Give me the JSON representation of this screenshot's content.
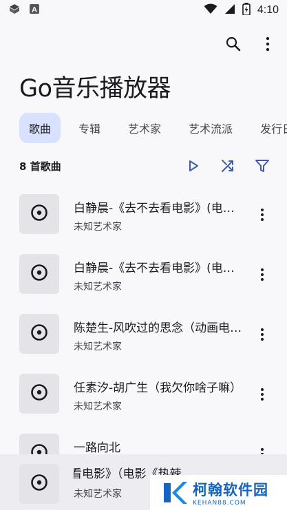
{
  "status_bar": {
    "time": "4:10",
    "left_icons": [
      "box-icon",
      "a-badge-icon"
    ],
    "right_icons": [
      "wifi-icon",
      "signal-icon",
      "battery-charging-icon"
    ]
  },
  "toolbar": {
    "search_icon": "search-icon",
    "more_icon": "more-vert-icon"
  },
  "app_title": "Go音乐播放器",
  "tabs": [
    {
      "label": "歌曲",
      "active": true
    },
    {
      "label": "专辑",
      "active": false
    },
    {
      "label": "艺术家",
      "active": false
    },
    {
      "label": "艺术流派",
      "active": false
    },
    {
      "label": "发行日期",
      "active": false
    }
  ],
  "list_header": {
    "count_label": "8 首歌曲",
    "actions": [
      "play-icon",
      "shuffle-icon",
      "filter-icon"
    ]
  },
  "songs": [
    {
      "title": "白静晨-《去不去看电影》(电影《热辣滚烫》片尾曲)",
      "artist": "未知艺术家"
    },
    {
      "title": "白静晨-《去不去看电影》(电影《热辣滚烫》主题曲)",
      "artist": "未知艺术家"
    },
    {
      "title": "陈楚生-风吹过的思念（动画电影主题曲）",
      "artist": "未知艺术家"
    },
    {
      "title": "任素汐-胡广生（我欠你啥子嘛）",
      "artist": "未知艺术家"
    },
    {
      "title": "一路向北",
      "artist": ""
    }
  ],
  "mini_player": {
    "title": "去看电影》（电影《热辣",
    "artist": "未知艺术家"
  },
  "watermark": {
    "name": "柯翰软件园",
    "url": "KEHAN88.COM"
  },
  "colors": {
    "accent": "#3f5aa9",
    "active_tab_bg": "#d8e2ff",
    "thumb_bg": "#e3e3e8",
    "watermark_blue": "#1565c0"
  }
}
